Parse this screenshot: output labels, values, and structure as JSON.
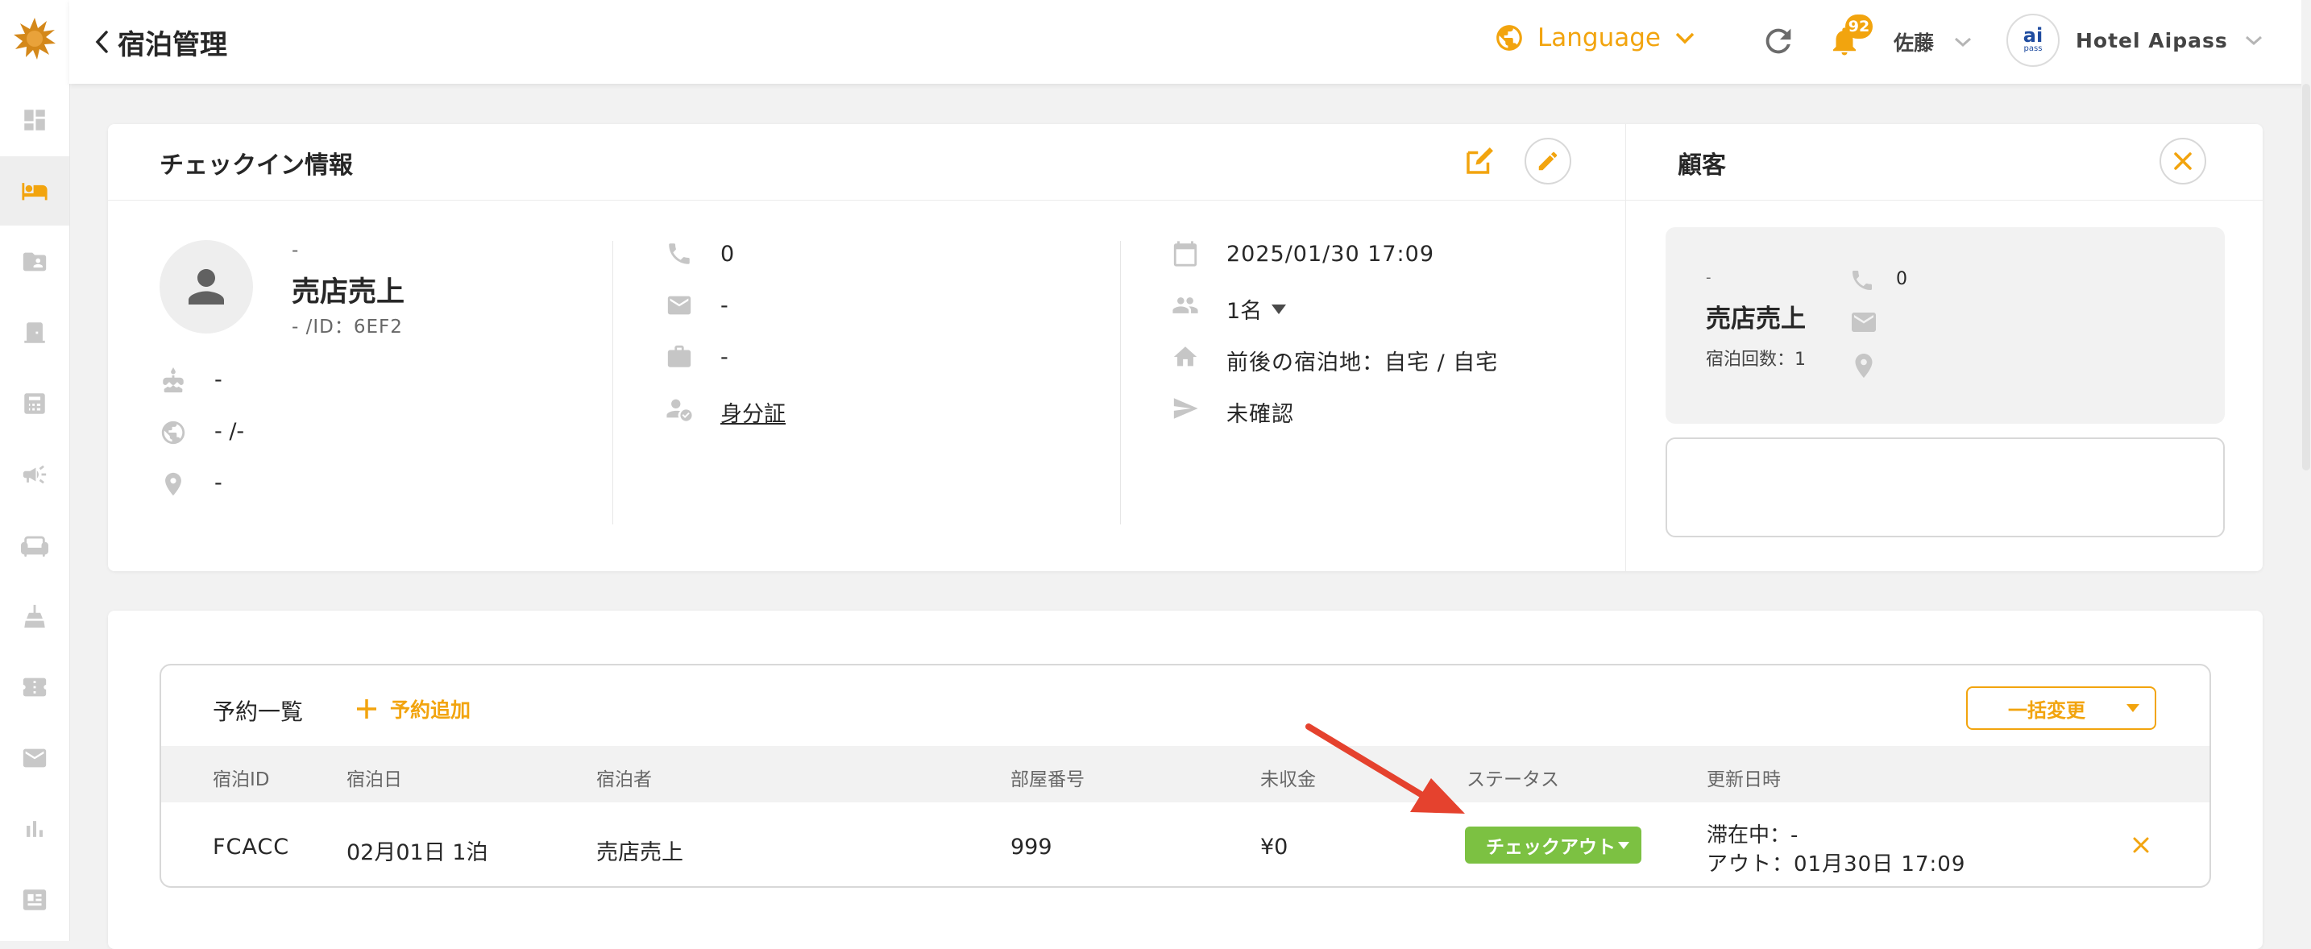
{
  "header": {
    "title": "宿泊管理",
    "language_label": "Language",
    "notification_count": "92",
    "user_name": "佐藤",
    "hotel_name": "Hotel Aipass",
    "avatar_text": "ai",
    "avatar_sub": "pass"
  },
  "checkin": {
    "title": "チェックイン情報",
    "guest_kana": "-",
    "guest_name": "売店売上",
    "guest_id_line": "- /ID：6EF2",
    "birthday": "-",
    "nationality": "- /-",
    "address": "-",
    "phone": "0",
    "email": "-",
    "company": "-",
    "id_document_label": "身分証",
    "checkin_datetime": "2025/01/30 17:09",
    "guests_count": "1名",
    "prev_next_stay": "前後の宿泊地：自宅 / 自宅",
    "confirmation_status": "未確認"
  },
  "customer": {
    "title": "顧客",
    "kana": "-",
    "name": "売店売上",
    "stay_count": "宿泊回数：1",
    "phone": "0"
  },
  "reservations": {
    "title": "予約一覧",
    "add_label": "予約追加",
    "bulk_change_label": "一括変更",
    "columns": [
      "宿泊ID",
      "宿泊日",
      "宿泊者",
      "部屋番号",
      "未収金",
      "ステータス",
      "更新日時"
    ],
    "rows": [
      {
        "id": "FCACC",
        "date": "02月01日 1泊",
        "guest": "売店売上",
        "room": "999",
        "unpaid": "¥0",
        "status": "チェックアウト",
        "updated_stay": "滞在中：-",
        "updated_out": "アウト：01月30日 17:09"
      }
    ]
  },
  "colors": {
    "accent": "#f2a40e",
    "status_green": "#7cc142",
    "arrow_red": "#e5422e"
  }
}
